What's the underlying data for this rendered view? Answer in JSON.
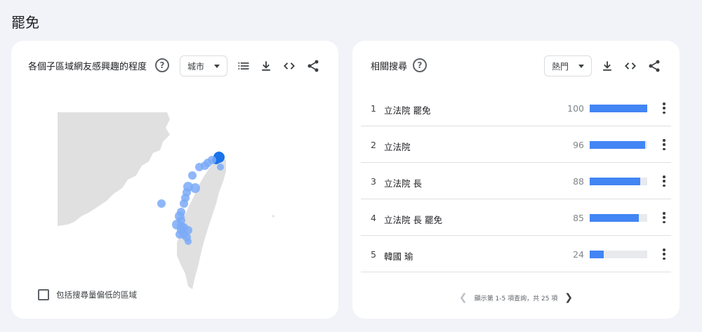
{
  "page": {
    "title": "罷免"
  },
  "left_panel": {
    "title": "各個子區域網友感興趣的程度",
    "help_glyph": "?",
    "dropdown": {
      "selected": "城市"
    },
    "icons": [
      "list-icon",
      "download-icon",
      "embed-icon",
      "share-icon"
    ],
    "checkbox_label": "包括搜尋量偏低的區域",
    "map": {
      "land_color": "#e0e0e0",
      "marker_color_light": "#7baaf7",
      "marker_color_dark": "#1a73e8"
    }
  },
  "right_panel": {
    "title": "相關搜尋",
    "help_glyph": "?",
    "dropdown": {
      "selected": "熱門"
    },
    "icons": [
      "download-icon",
      "embed-icon",
      "share-icon"
    ],
    "rows": [
      {
        "rank": "1",
        "query": "立法院 罷免",
        "value": "100",
        "value_num": 100
      },
      {
        "rank": "2",
        "query": "立法院",
        "value": "96",
        "value_num": 96
      },
      {
        "rank": "3",
        "query": "立法院 長",
        "value": "88",
        "value_num": 88
      },
      {
        "rank": "4",
        "query": "立法院 長 罷免",
        "value": "85",
        "value_num": 85
      },
      {
        "rank": "5",
        "query": "韓國 瑜",
        "value": "24",
        "value_num": 24
      }
    ],
    "pager": {
      "text": "顯示第 1-5 項查詢，共 25 項"
    },
    "bar_color": "#4285f4"
  }
}
